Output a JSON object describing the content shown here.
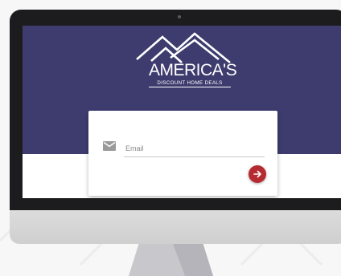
{
  "brand": {
    "name": "AMERICA'S",
    "tagline": "DISCOUNT HOME DEALS"
  },
  "form": {
    "email_placeholder": "Email",
    "email_value": "",
    "submit_icon": "arrow-right-icon"
  },
  "colors": {
    "hero": "#3e3c6e",
    "accent": "#b62b32",
    "bezel": "#1c1c1e"
  }
}
